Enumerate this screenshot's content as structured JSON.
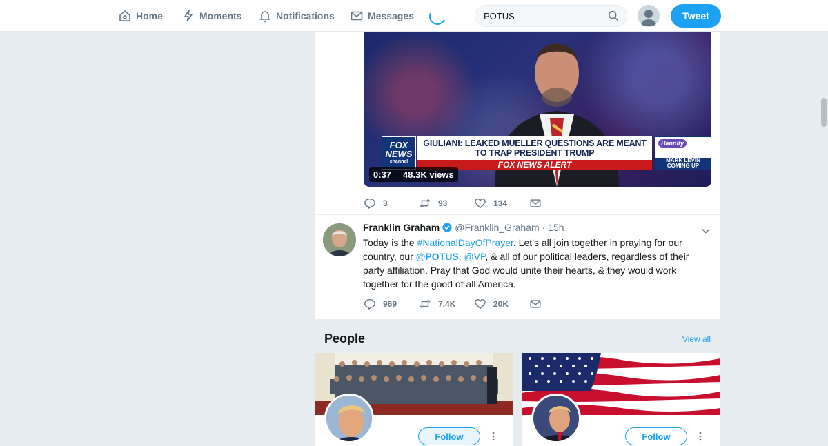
{
  "nav": {
    "home": "Home",
    "moments": "Moments",
    "notifications": "Notifications",
    "messages": "Messages"
  },
  "search": {
    "value": "POTUS"
  },
  "tweet_button": "Tweet",
  "tweet1": {
    "video": {
      "logo_line1": "FOX",
      "logo_line2": "NEWS",
      "logo_line3": "channel",
      "headline": "GIULIANI: LEAKED MUELLER QUESTIONS ARE MEANT TO TRAP PRESIDENT TRUMP",
      "alert": "FOX NEWS ALERT",
      "promo_show": "Hannity",
      "promo_label": "MARK LEVIN COMING UP",
      "duration": "0:37",
      "views": "48.3K views"
    },
    "stats": {
      "replies": "3",
      "retweets": "93",
      "likes": "134"
    }
  },
  "tweet2": {
    "name": "Franklin Graham",
    "handle": "@Franklin_Graham",
    "time": "· 15h",
    "text_parts": {
      "p1": "Today is the ",
      "hashtag": "#NationalDayOfPrayer",
      "p2": ". Let’s all join together in praying for our country, our ",
      "mention1": "@POTUS",
      "p3": ", ",
      "mention2": "@VP",
      "p4": ", & all of our political leaders, regardless of their party affiliation. Pray that God would unite their hearts, & they would work together for the good of all America."
    },
    "stats": {
      "replies": "969",
      "retweets": "7.4K",
      "likes": "20K"
    }
  },
  "people": {
    "title": "People",
    "view_all": "View all",
    "cards": [
      {
        "follow_label": "Follow"
      },
      {
        "follow_label": "Follow"
      }
    ]
  },
  "colors": {
    "accent": "#1da1f2",
    "background": "#e6ecf0",
    "muted": "#657786"
  }
}
